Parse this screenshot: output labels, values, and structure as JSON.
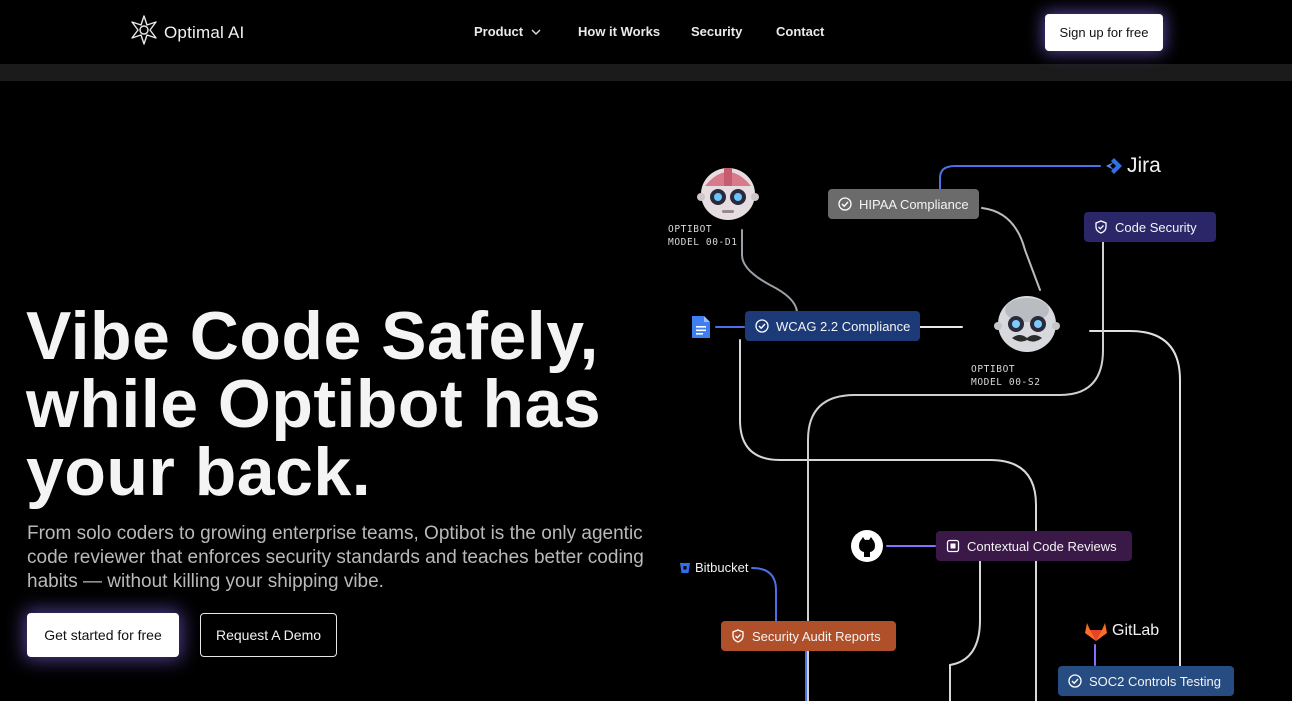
{
  "nav": {
    "logo_text": "Optimal AI",
    "links": [
      "Product",
      "How it Works",
      "Security",
      "Contact"
    ],
    "cta": "Sign up for free"
  },
  "hero": {
    "title_lines": [
      "Vibe Code Safely,",
      "while Optibot has",
      "your back."
    ],
    "subtitle": "From solo coders to growing enterprise teams, Optibot is the only agentic code reviewer that enforces security standards and teaches better coding habits — without killing your shipping vibe.",
    "primary_cta": "Get started for free",
    "secondary_cta": "Request A Demo"
  },
  "diagram": {
    "bots": [
      {
        "line1": "OPTIBOT",
        "line2": "MODEL 00-D1",
        "icon": "robot-pink-icon"
      },
      {
        "line1": "OPTIBOT",
        "line2": "MODEL 00-S2",
        "icon": "robot-mustache-icon"
      }
    ],
    "pills": {
      "hipaa": "HIPAA Compliance",
      "code_security": "Code Security",
      "wcag": "WCAG 2.2 Compliance",
      "contextual": "Contextual Code Reviews",
      "security_audit": "Security Audit Reports",
      "soc2": "SOC2 Controls Testing"
    },
    "integrations": {
      "jira": "Jira",
      "bitbucket": "Bitbucket",
      "gitlab": "GitLab"
    },
    "colors": {
      "hipaa": "#6b6b6b",
      "code_security": "#2a2668",
      "wcag": "#1d3a78",
      "contextual": "#3a1848",
      "security_audit": "#b0502a",
      "soc2": "#274c82",
      "glow": "#8c6eff"
    }
  }
}
